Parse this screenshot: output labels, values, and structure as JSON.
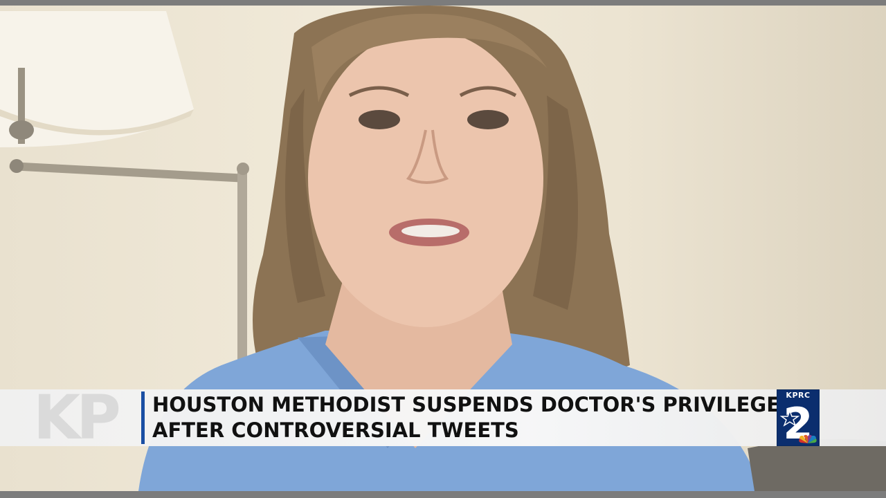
{
  "broadcast": {
    "headline_line1": "HOUSTON METHODIST SUSPENDS DOCTOR'S PRIVILEGES",
    "headline_line2": "AFTER CONTROVERSIAL TWEETS",
    "watermark_logo": "KP",
    "station_call_letters": "KPRC",
    "station_channel": "2",
    "network_logo": "nbc-peacock-icon"
  },
  "colors": {
    "divider": "#1a4fa3",
    "badge_bg": "#0b2e6e",
    "scrubs": "#7fa6d8",
    "wall": "#efe7d5"
  }
}
